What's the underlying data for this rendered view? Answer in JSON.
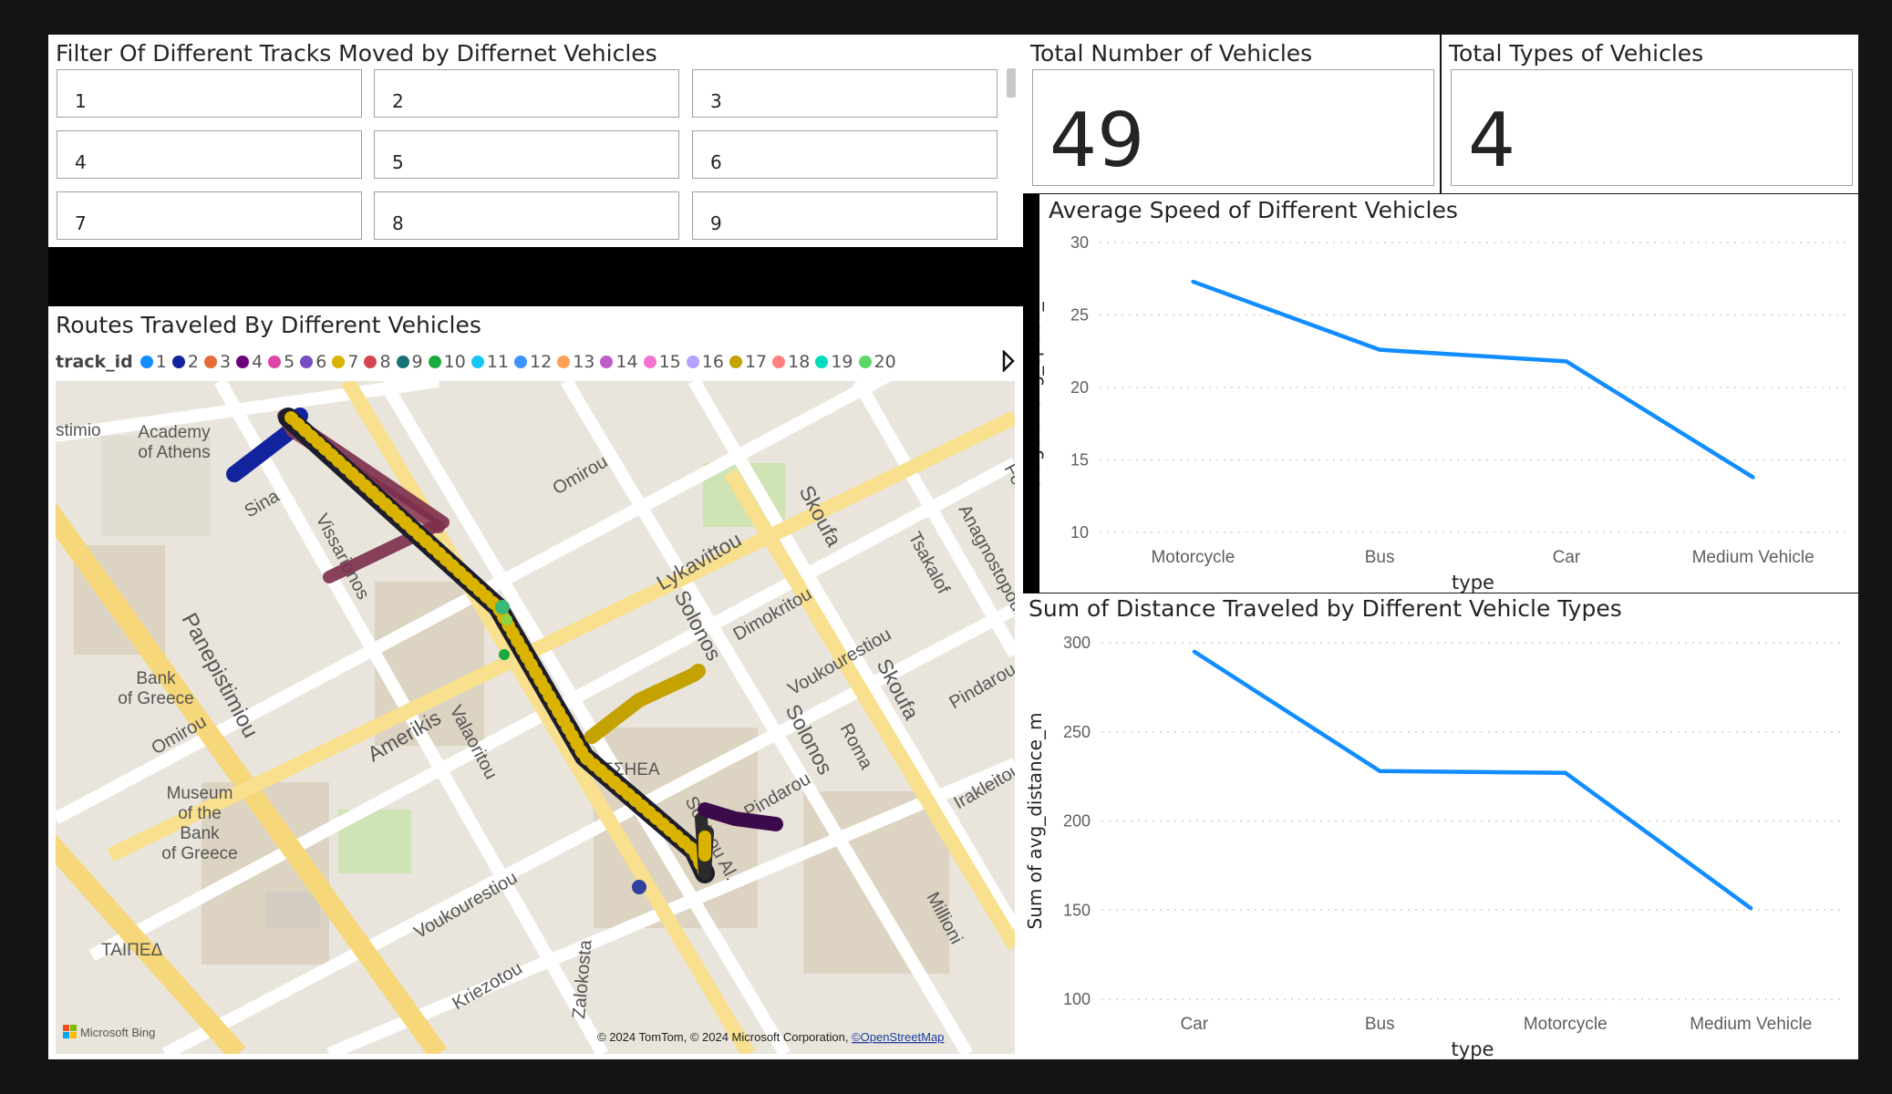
{
  "slicer": {
    "title": "Filter Of Different Tracks Moved by Differnet Vehicles",
    "items": [
      "1",
      "2",
      "3",
      "4",
      "5",
      "6",
      "7",
      "8",
      "9"
    ]
  },
  "card_total": {
    "title": "Total Number of Vehicles",
    "value": "49"
  },
  "card_types": {
    "title": "Total Types of Vehicles",
    "value": "4"
  },
  "map": {
    "title": "Routes Traveled By Different Vehicles",
    "legend_title": "track_id",
    "legend": [
      {
        "label": "1",
        "color": "#118DFF"
      },
      {
        "label": "2",
        "color": "#12239E"
      },
      {
        "label": "3",
        "color": "#E66C37"
      },
      {
        "label": "4",
        "color": "#6B007B"
      },
      {
        "label": "5",
        "color": "#E044A7"
      },
      {
        "label": "6",
        "color": "#744EC2"
      },
      {
        "label": "7",
        "color": "#D9B300"
      },
      {
        "label": "8",
        "color": "#D64550"
      },
      {
        "label": "9",
        "color": "#197278"
      },
      {
        "label": "10",
        "color": "#1AAB40"
      },
      {
        "label": "11",
        "color": "#15C6F4"
      },
      {
        "label": "12",
        "color": "#4092FF"
      },
      {
        "label": "13",
        "color": "#FFA058"
      },
      {
        "label": "14",
        "color": "#BE5DC9"
      },
      {
        "label": "15",
        "color": "#F472D0"
      },
      {
        "label": "16",
        "color": "#B5A1FF"
      },
      {
        "label": "17",
        "color": "#C4A200"
      },
      {
        "label": "18",
        "color": "#FF8080"
      },
      {
        "label": "19",
        "color": "#00DBBC"
      },
      {
        "label": "20",
        "color": "#5BD667"
      }
    ],
    "labels": {
      "academy": [
        "Academy",
        "of Athens"
      ],
      "bank": [
        "Bank",
        "of Greece"
      ],
      "museum": [
        "Museum",
        "of the",
        "Bank",
        "of Greece"
      ],
      "stimio": "stimio",
      "taiped": "ΤΑΙΠΕΔ",
      "sea": "ΣΣΗΕΑ",
      "streets": [
        "Sina",
        "Vissarionos",
        "Panepistimiou",
        "Omirou",
        "Amerikis",
        "Valaoritou",
        "Lykavittou",
        "Solonos",
        "Skoufa",
        "Dimokritou",
        "Voukourestiou",
        "Tsakalof",
        "Anagnostopoulou",
        "Pindarou",
        "Roma",
        "Soutsou Al.",
        "Irakleitou",
        "Millioni",
        "Kriezotou",
        "Zalokosta",
        "Fok"
      ],
      "bing": "Microsoft Bing",
      "copyright": "© 2024 TomTom, © 2024 Microsoft Corporation, ",
      "osm": "©OpenStreetMap"
    }
  },
  "chart_data": [
    {
      "type": "line",
      "title": "Average Speed of Different Vehicles",
      "xlabel": "type",
      "ylabel": "Average of avg_speed_kmh",
      "categories": [
        "Motorcycle",
        "Bus",
        "Car",
        "Medium Vehicle"
      ],
      "values": [
        27.3,
        22.6,
        21.8,
        13.8
      ],
      "ylim": [
        10,
        30
      ],
      "yticks": [
        10,
        15,
        20,
        25,
        30
      ],
      "color": "#118DFF",
      "grid": true
    },
    {
      "type": "line",
      "title": "Sum of Distance Traveled by Different Vehicle Types",
      "xlabel": "type",
      "ylabel": "Sum of avg_distance_m",
      "categories": [
        "Car",
        "Bus",
        "Motorcycle",
        "Medium Vehicle"
      ],
      "values": [
        295,
        228,
        227,
        151
      ],
      "ylim": [
        100,
        300
      ],
      "yticks": [
        100,
        150,
        200,
        250,
        300
      ],
      "color": "#118DFF",
      "grid": true
    }
  ]
}
